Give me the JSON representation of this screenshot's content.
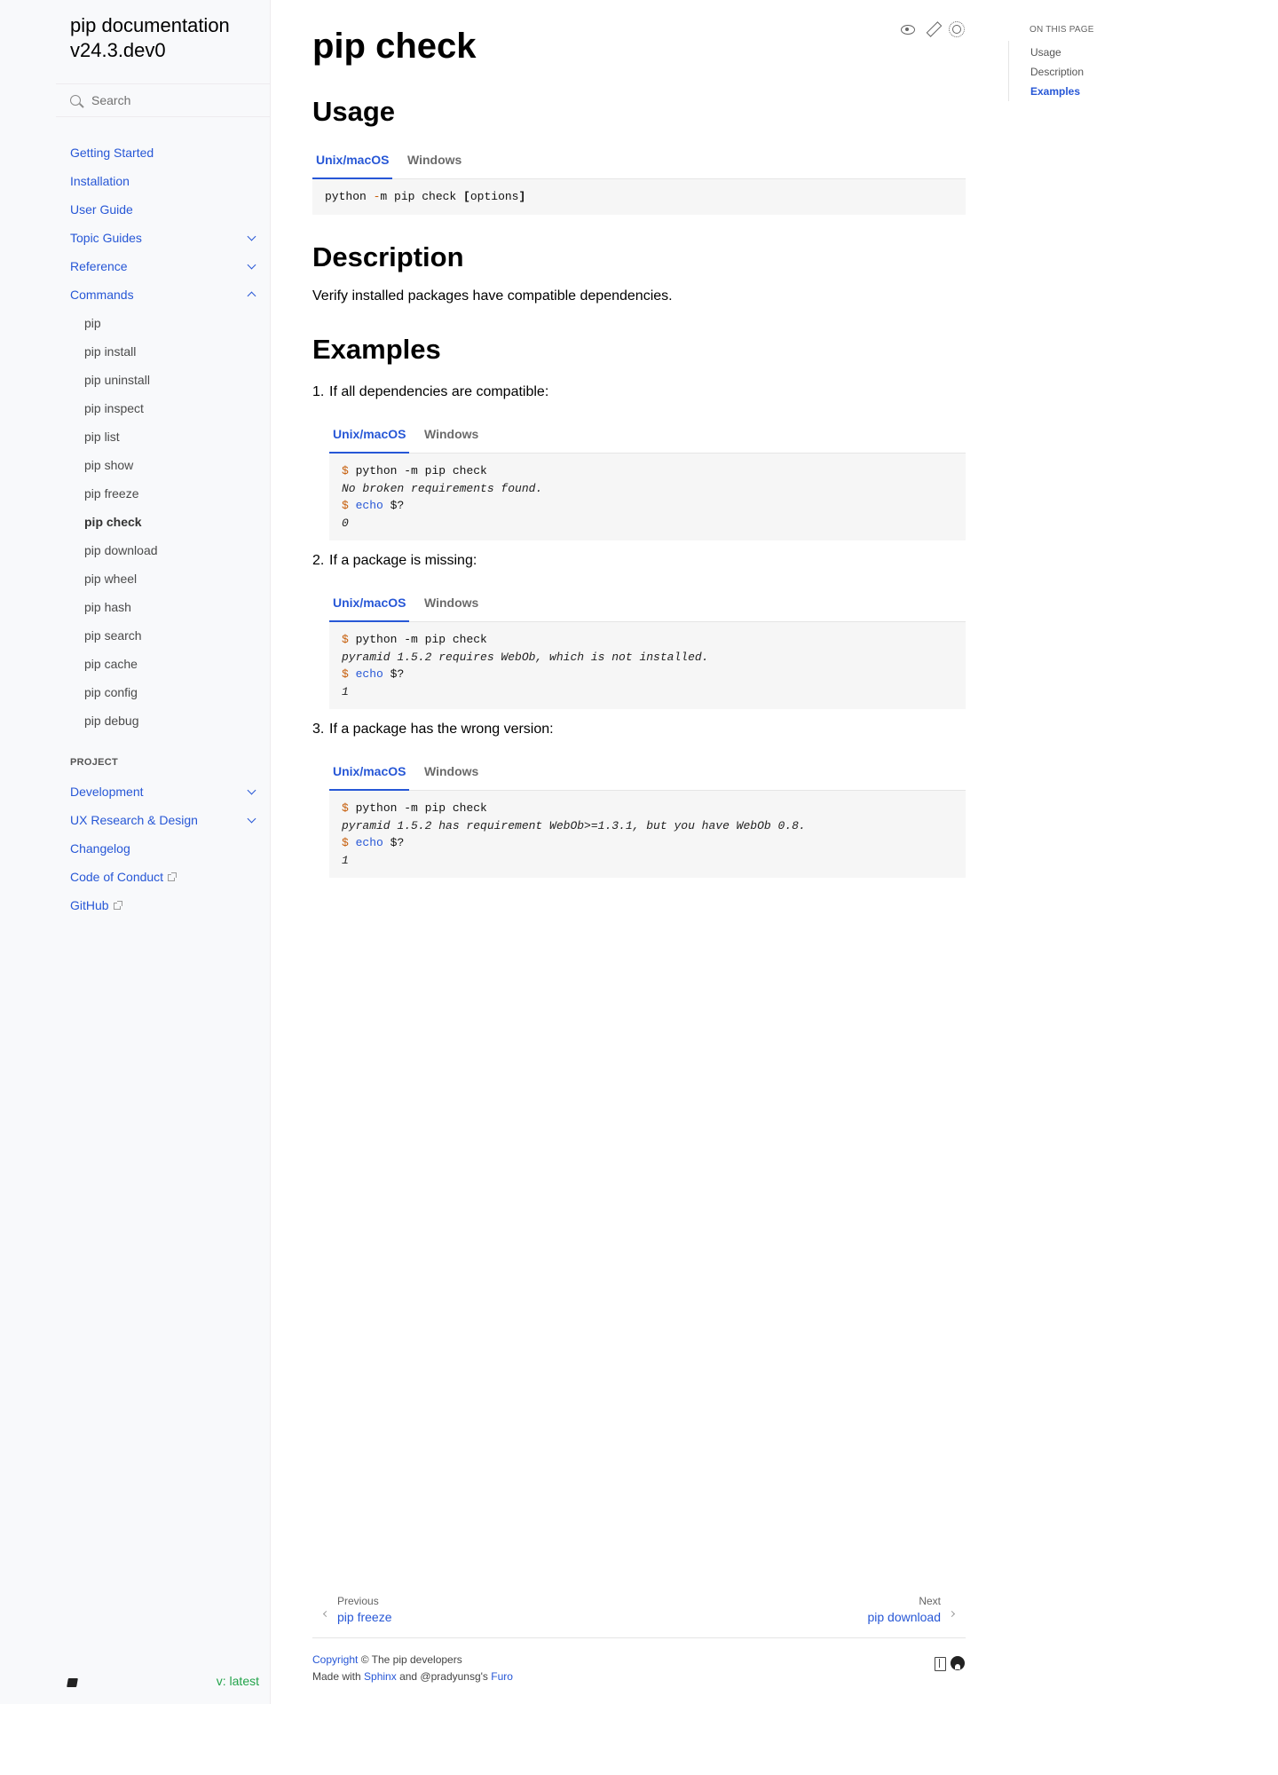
{
  "sidebar": {
    "brand": "pip documentation v24.3.dev0",
    "search_placeholder": "Search",
    "nav": [
      {
        "label": "Getting Started"
      },
      {
        "label": "Installation"
      },
      {
        "label": "User Guide"
      },
      {
        "label": "Topic Guides",
        "expandable": true
      },
      {
        "label": "Reference",
        "expandable": true
      },
      {
        "label": "Commands",
        "expandable": true,
        "expanded": true
      }
    ],
    "commands": [
      "pip",
      "pip install",
      "pip uninstall",
      "pip inspect",
      "pip list",
      "pip show",
      "pip freeze",
      "pip check",
      "pip download",
      "pip wheel",
      "pip hash",
      "pip search",
      "pip cache",
      "pip config",
      "pip debug"
    ],
    "current_command": "pip check",
    "project_caption": "PROJECT",
    "project": [
      {
        "label": "Development",
        "expandable": true
      },
      {
        "label": "UX Research & Design",
        "expandable": true
      },
      {
        "label": "Changelog"
      },
      {
        "label": "Code of Conduct",
        "external": true
      },
      {
        "label": "GitHub",
        "external": true
      }
    ],
    "version": "v: latest",
    "icons": [
      "search-icon",
      "chevron-down-icon",
      "chevron-up-icon",
      "external-link-icon",
      "book-icon"
    ]
  },
  "main": {
    "title": "pip check",
    "toolbar_icons": [
      "eye-icon",
      "edit-icon",
      "theme-icon"
    ],
    "usage": {
      "heading": "Usage",
      "tabs": [
        "Unix/macOS",
        "Windows"
      ],
      "active_tab": "Unix/macOS",
      "code": {
        "cmd": "python ",
        "op": "-",
        "rest": "m pip check ",
        "lbr": "[",
        "opt": "options",
        "rbr": "]"
      }
    },
    "description": {
      "heading": "Description",
      "text": "Verify installed packages have compatible dependencies."
    },
    "examples": {
      "heading": "Examples",
      "items": [
        {
          "num": "1.",
          "text": "If all dependencies are compatible:",
          "tabs": [
            "Unix/macOS",
            "Windows"
          ],
          "cmd": "python -m pip check",
          "output": "No broken requirements found.",
          "echo_args": "$?",
          "result": "0"
        },
        {
          "num": "2.",
          "text": "If a package is missing:",
          "tabs": [
            "Unix/macOS",
            "Windows"
          ],
          "cmd": "python -m pip check",
          "output": "pyramid 1.5.2 requires WebOb, which is not installed.",
          "echo_args": "$?",
          "result": "1"
        },
        {
          "num": "3.",
          "text": "If a package has the wrong version:",
          "tabs": [
            "Unix/macOS",
            "Windows"
          ],
          "cmd": "python -m pip check",
          "output": "pyramid 1.5.2 has requirement WebOb>=1.3.1, but you have WebOb 0.8.",
          "echo_args": "$?",
          "result": "1"
        }
      ],
      "prompt": "$",
      "echo": "echo"
    },
    "footer": {
      "prev_label": "Previous",
      "prev_title": "pip freeze",
      "next_label": "Next",
      "next_title": "pip download",
      "copyright_link": "Copyright",
      "copyright_text": " © The pip developers",
      "made_with": "Made with ",
      "sphinx": "Sphinx",
      "and_text": " and @pradyunsg's ",
      "furo": "Furo",
      "icons": [
        "read-the-docs-icon",
        "github-icon"
      ]
    }
  },
  "toc": {
    "title": "ON THIS PAGE",
    "items": [
      "Usage",
      "Description",
      "Examples"
    ],
    "active": "Examples"
  },
  "colors": {
    "link": "#2757d6",
    "sidebar_bg": "#f8f9fb",
    "code_bg": "#f6f6f6",
    "prompt": "#c65d09",
    "version": "#22a34a"
  }
}
